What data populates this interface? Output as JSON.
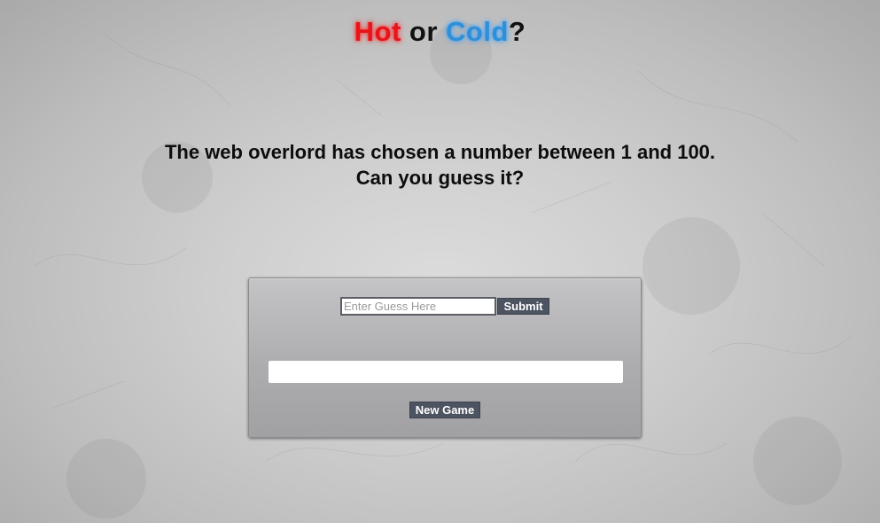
{
  "title": {
    "hot": "Hot",
    "or": " or ",
    "cold": "Cold",
    "question": "?"
  },
  "intro": {
    "line1": "The web overlord has chosen a number between 1 and 100.",
    "line2": "Can you guess it?"
  },
  "game": {
    "guess_placeholder": "Enter Guess Here",
    "guess_value": "",
    "submit_label": "Submit",
    "feedback_text": "",
    "new_game_label": "New Game"
  },
  "colors": {
    "hot": "#e8141a",
    "cold": "#2f8fd8",
    "button_bg": "#4c5361",
    "panel_bg": "#adadaf"
  }
}
